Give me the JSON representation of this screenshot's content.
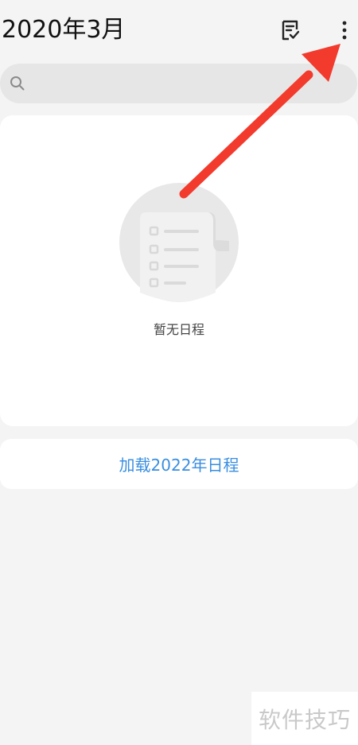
{
  "header": {
    "title": "2020年3月",
    "icons": {
      "todo": "todo-checklist-icon",
      "more": "more-vertical-icon"
    }
  },
  "search": {
    "value": "",
    "placeholder": "",
    "icon": "search-icon"
  },
  "empty_state": {
    "icon": "empty-schedule-icon",
    "text": "暂无日程"
  },
  "load_more": {
    "label": "加载2022年日程"
  },
  "watermark": {
    "text": "软件技巧"
  },
  "annotation": {
    "arrow_color": "#f23a2d"
  },
  "colors": {
    "background": "#f4f4f4",
    "card": "#ffffff",
    "accent": "#3a8ee0"
  }
}
